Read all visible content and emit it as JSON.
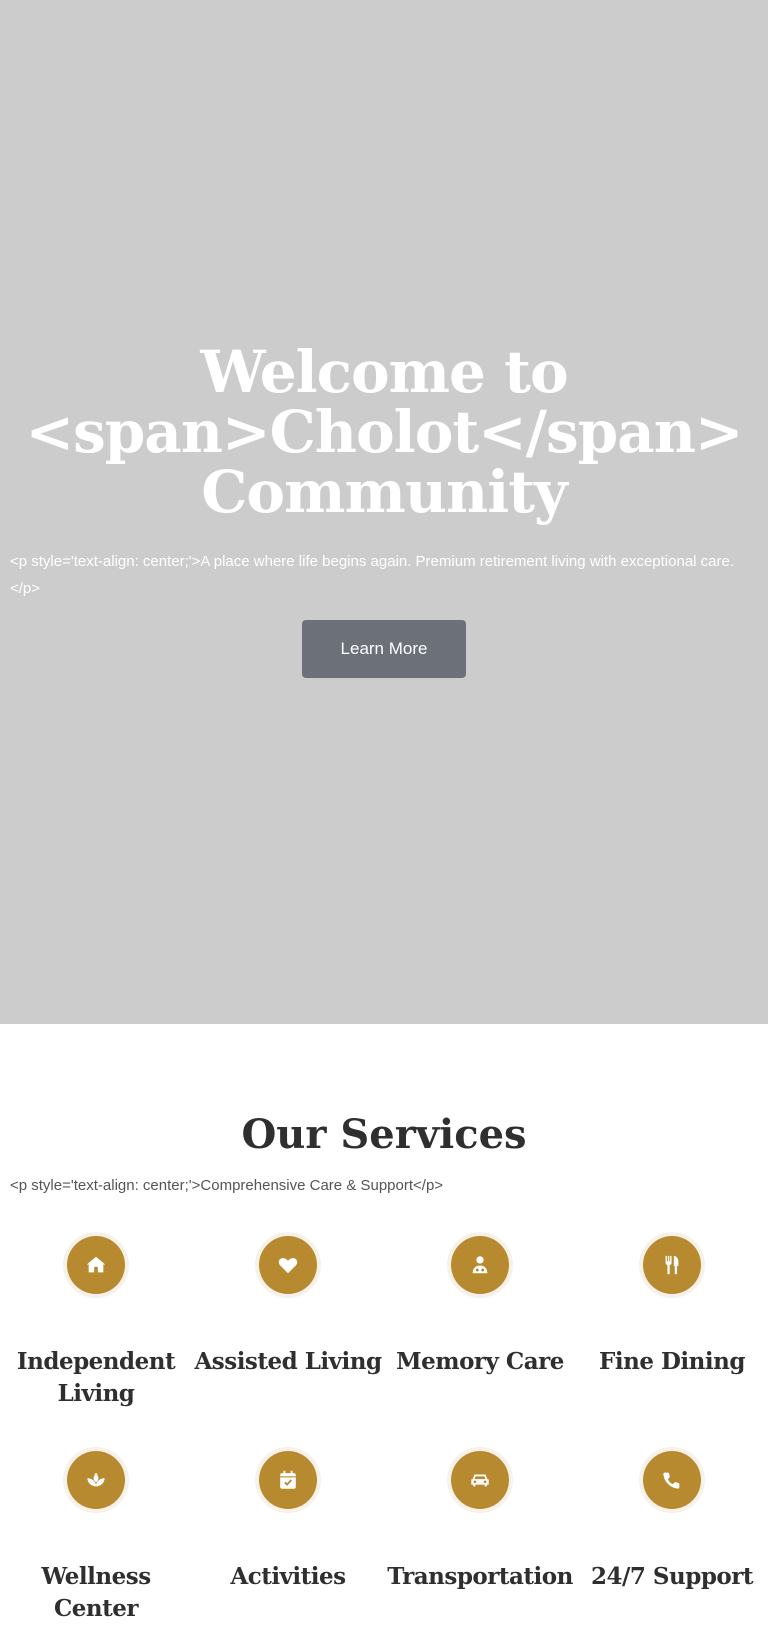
{
  "hero": {
    "title_line1": "Welcome to",
    "title_line2": "<span>Cholot</span>",
    "title_line3": "Community",
    "subtitle": "<p style='text-align: center;'>A place where life begins again. Premium retirement living with exceptional care.</p>",
    "button_label": "Learn More"
  },
  "services": {
    "title": "Our Services",
    "subtitle": "<p style='text-align: center;'>Comprehensive Care & Support</p>",
    "items": [
      {
        "label": "Independent Living",
        "icon": "home-icon"
      },
      {
        "label": "Assisted Living",
        "icon": "heart-icon"
      },
      {
        "label": "Memory Care",
        "icon": "doctor-icon"
      },
      {
        "label": "Fine Dining",
        "icon": "utensils-icon"
      },
      {
        "label": "Wellness Center",
        "icon": "spa-icon"
      },
      {
        "label": "Activities",
        "icon": "calendar-check-icon"
      },
      {
        "label": "Transportation",
        "icon": "car-icon"
      },
      {
        "label": "24/7 Support",
        "icon": "phone-icon"
      }
    ]
  },
  "colors": {
    "hero_background": "#cccccc",
    "accent_gold": "#b78a2f",
    "button_gray": "#6b7079",
    "heading_dark": "#2f2f2f"
  }
}
